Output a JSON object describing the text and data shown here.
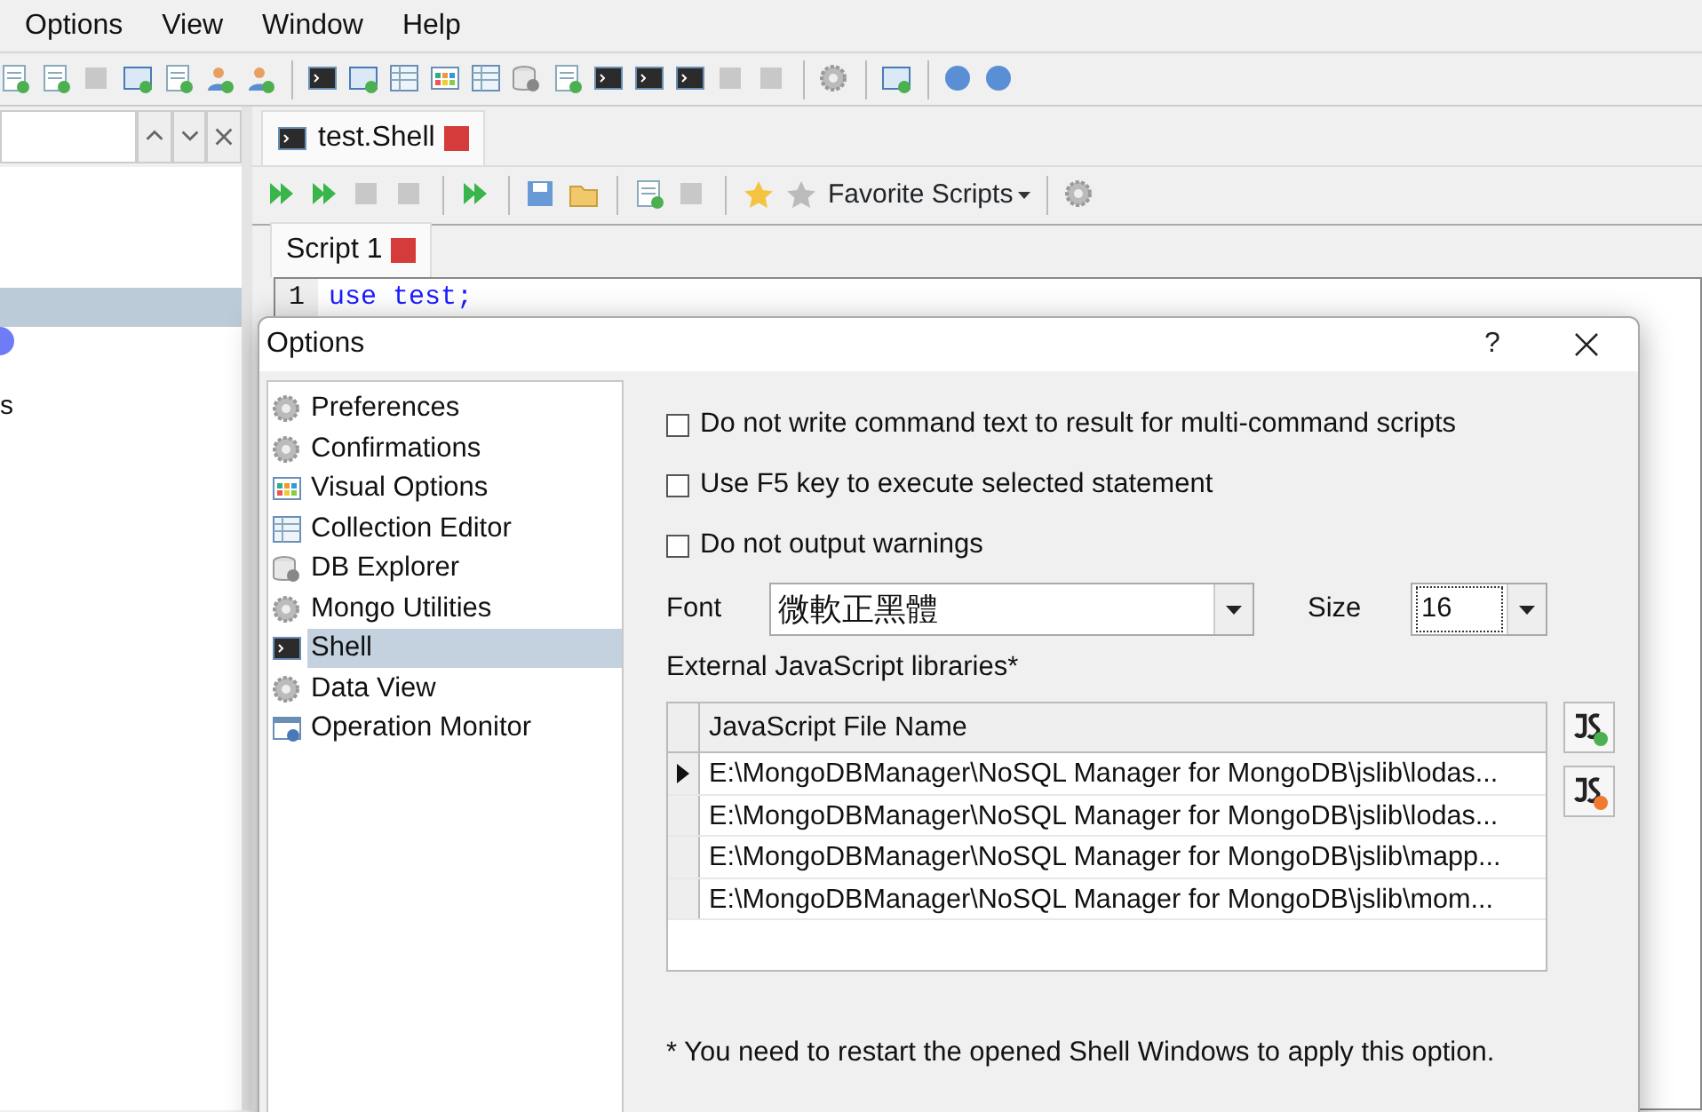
{
  "menu": [
    {
      "label": "Options"
    },
    {
      "label": "View"
    },
    {
      "label": "Window"
    },
    {
      "label": "Help"
    }
  ],
  "left_panel": {
    "fragment": "s"
  },
  "document_tab": {
    "label": "test.Shell"
  },
  "shell_toolbar": {
    "favorites_label": "Favorite Scripts"
  },
  "script_tab": {
    "label": "Script 1"
  },
  "editor": {
    "line_number": "1",
    "code": "use test;"
  },
  "dialog": {
    "title": "Options",
    "help": "?",
    "categories": [
      {
        "label": "Preferences",
        "selected": false
      },
      {
        "label": "Confirmations",
        "selected": false
      },
      {
        "label": "Visual Options",
        "selected": false
      },
      {
        "label": "Collection Editor",
        "selected": false
      },
      {
        "label": "DB Explorer",
        "selected": false
      },
      {
        "label": "Mongo Utilities",
        "selected": false
      },
      {
        "label": "Shell",
        "selected": true
      },
      {
        "label": "Data View",
        "selected": false
      },
      {
        "label": "Operation Monitor",
        "selected": false
      }
    ],
    "checkboxes": [
      {
        "label": "Do not write command text to result for multi-command scripts",
        "checked": false
      },
      {
        "label": "Use F5 key to execute selected statement",
        "checked": false
      },
      {
        "label": "Do not output warnings",
        "checked": false
      }
    ],
    "font": {
      "label": "Font",
      "value": "微軟正黑體"
    },
    "size": {
      "label": "Size",
      "value": "16"
    },
    "libraries": {
      "label": "External JavaScript libraries*",
      "column": "JavaScript File Name",
      "rows": [
        {
          "path": "E:\\MongoDBManager\\NoSQL Manager for MongoDB\\jslib\\lodas...",
          "selected": true
        },
        {
          "path": "E:\\MongoDBManager\\NoSQL Manager for MongoDB\\jslib\\lodas...",
          "selected": false
        },
        {
          "path": "E:\\MongoDBManager\\NoSQL Manager for MongoDB\\jslib\\mapp...",
          "selected": false
        },
        {
          "path": "E:\\MongoDBManager\\NoSQL Manager for MongoDB\\jslib\\mom...",
          "selected": false
        }
      ]
    },
    "note": "* You need to restart the opened Shell Windows to apply this option."
  }
}
